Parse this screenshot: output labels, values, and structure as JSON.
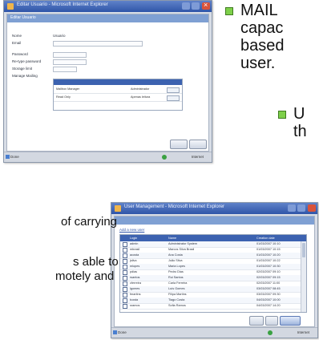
{
  "window_edit": {
    "title": "Editar Usuario - Microsoft Internet Explorer",
    "header": "Editar Usuario",
    "fields": [
      {
        "label": "Nome",
        "value": "Usuario"
      },
      {
        "label": "Email",
        "value": ""
      },
      {
        "label": "Password",
        "value": ""
      },
      {
        "label": "Re-type password",
        "value": ""
      },
      {
        "label": "Storage limit",
        "value": ""
      },
      {
        "label": "Manage Mailing",
        "value": ""
      }
    ],
    "rights_rows": [
      {
        "name": "Mailbox Manager",
        "role": "Administrador"
      },
      {
        "name": "Read Only",
        "role": "Apenas leitura"
      }
    ],
    "buttons": {
      "ok": "OK",
      "cancel": "Cancelar"
    },
    "status_left": "Done",
    "status_right": "Internet"
  },
  "window_list": {
    "title": "User Management - Microsoft Internet Explorer",
    "link": "Add a new user",
    "columns": [
      "Login",
      "Name",
      "Creation date"
    ],
    "rows": [
      [
        "admin",
        "Administrator System",
        "01/03/2007 10:10"
      ],
      [
        "mbrasil",
        "Marcos Silva Brasil",
        "01/03/2007 10:15"
      ],
      [
        "acosta",
        "Ana Costa",
        "01/03/2007 10:20"
      ],
      [
        "jsilva",
        "João Silva",
        "01/03/2007 10:22"
      ],
      [
        "mlopes",
        "Maria Lopes",
        "01/03/2007 10:30"
      ],
      [
        "pdias",
        "Pedro Dias",
        "02/03/2007 09:10"
      ],
      [
        "rsantos",
        "Rui Santos",
        "02/03/2007 09:15"
      ],
      [
        "cferreira",
        "Carla Ferreira",
        "02/03/2007 11:00"
      ],
      [
        "lgomes",
        "Luís Gomes",
        "03/03/2007 08:45"
      ],
      [
        "fmartins",
        "Filipa Martins",
        "03/03/2007 09:30"
      ],
      [
        "tcosta",
        "Tiago Costa",
        "04/03/2007 10:00"
      ],
      [
        "sramos",
        "Sofia Ramos",
        "04/03/2007 14:20"
      ]
    ],
    "buttons": {
      "delete": "Delete",
      "edit": "Edit",
      "new": "New"
    },
    "status_left": "Done",
    "status_right": "Internet"
  },
  "slide": {
    "bullet1_lines": [
      "MAIL",
      "capac",
      "based",
      "user."
    ],
    "bullet2_lines": [
      "U",
      "th"
    ],
    "body_lines": [
      "of carrying",
      "s able to",
      "motely and"
    ]
  },
  "colors": {
    "accent": "#3c62b0",
    "bullet": "#7ed04a"
  }
}
